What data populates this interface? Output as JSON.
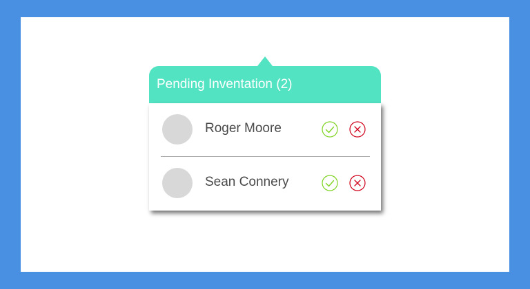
{
  "popover": {
    "title": "Pending Inventation (2)",
    "requests": [
      {
        "name": "Roger Moore",
        "accept_icon": "check-circle-icon",
        "decline_icon": "x-circle-icon"
      },
      {
        "name": "Sean Connery",
        "accept_icon": "check-circle-icon",
        "decline_icon": "x-circle-icon"
      }
    ]
  },
  "colors": {
    "page_background": "#4a90e2",
    "header_background": "#52e3c2",
    "accept": "#7ed321",
    "decline": "#d0021b",
    "avatar_placeholder": "#d8d8d8",
    "name_text": "#4a4a4a"
  }
}
